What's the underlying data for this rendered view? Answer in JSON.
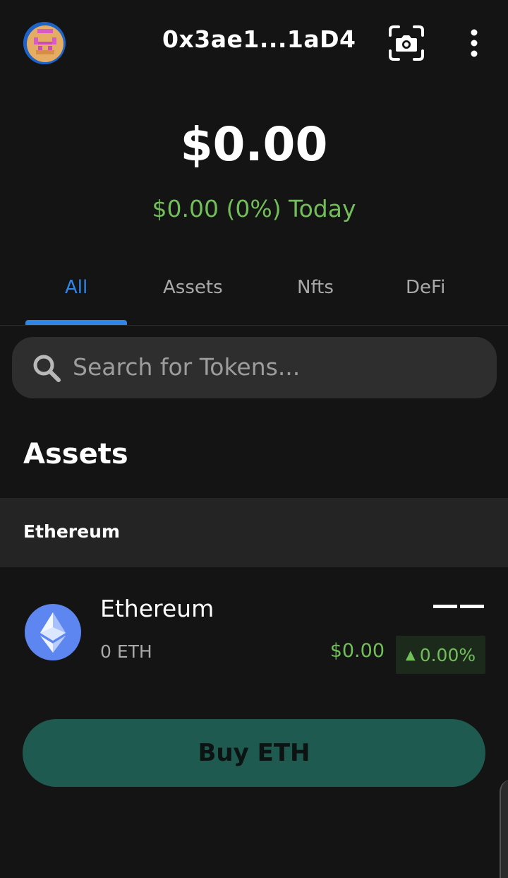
{
  "header": {
    "avatar_icon": "pixel-avatar-icon",
    "address": "0x3ae1...1aD4",
    "scan_icon": "camera-scan-icon",
    "menu_icon": "more-vertical-icon"
  },
  "portfolio": {
    "balance": "$0.00",
    "change": "$0.00 (0%) Today"
  },
  "tabs": [
    {
      "label": "All",
      "active": true
    },
    {
      "label": "Assets",
      "active": false
    },
    {
      "label": "Nfts",
      "active": false
    },
    {
      "label": "DeFi",
      "active": false
    }
  ],
  "search": {
    "placeholder": "Search for Tokens..."
  },
  "assets_section": {
    "title": "Assets",
    "group": "Ethereum",
    "items": [
      {
        "name": "Ethereum",
        "balance": "0 ETH",
        "value": "——",
        "price": "$0.00",
        "change": "0.00%",
        "trend": "up"
      }
    ]
  },
  "buy_button": {
    "label": "Buy ETH"
  },
  "colors": {
    "background": "#141414",
    "accent_blue": "#2f86e6",
    "positive_green": "#72bf5a",
    "buy_button": "#1f5a50",
    "eth_icon": "#5d86f1"
  }
}
